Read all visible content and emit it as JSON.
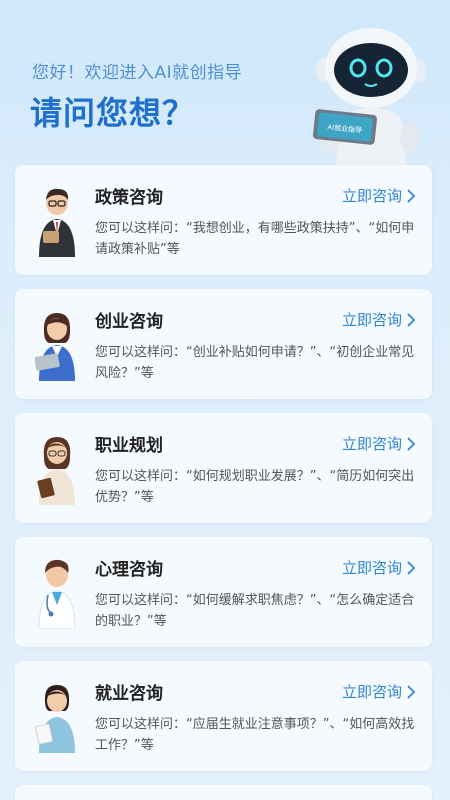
{
  "header": {
    "greeting": "您好！欢迎进入AI就创指导",
    "question": "请问您想？",
    "robot_screen_text": "AI就业指导"
  },
  "cards": [
    {
      "title": "政策咨询",
      "action": "立即咨询",
      "desc": "您可以这样问：“我想创业，有哪些政策扶持”、“如何申请政策补贴”等",
      "avatar": "advisor-man-icon"
    },
    {
      "title": "创业咨询",
      "action": "立即咨询",
      "desc": "您可以这样问：“创业补贴如何申请？”、“初创企业常见风险？”等",
      "avatar": "woman-laptop-icon"
    },
    {
      "title": "职业规划",
      "action": "立即咨询",
      "desc": "您可以这样问：“如何规划职业发展？”、“简历如何突出优势？”等",
      "avatar": "woman-book-icon"
    },
    {
      "title": "心理咨询",
      "action": "立即咨询",
      "desc": "您可以这样问：“如何缓解求职焦虑？”、“怎么确定适合的职业？”等",
      "avatar": "doctor-icon"
    },
    {
      "title": "就业咨询",
      "action": "立即咨询",
      "desc": "您可以这样问：“应届生就业注意事项？”、“如何高效找工作？”等",
      "avatar": "woman-document-icon"
    }
  ],
  "colors": {
    "accent": "#2f86d4",
    "title_blue": "#1f6fcf",
    "greeting_blue": "#4f8fd6"
  }
}
